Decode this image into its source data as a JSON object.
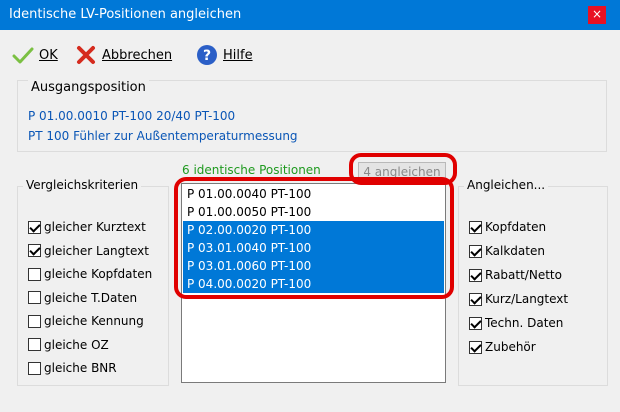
{
  "window": {
    "title": "Identische LV-Positionen angleichen",
    "close_glyph": "×"
  },
  "toolbar": {
    "ok_label": "OK",
    "ok_icon": "checkmark-icon",
    "cancel_label": "Abbrechen",
    "cancel_icon": "red-x-icon",
    "help_label": "Hilfe",
    "help_icon": "help-icon"
  },
  "source": {
    "caption": "Ausgangsposition",
    "line1": "P  01.00.0010  PT-100 20/40  PT-100",
    "line2": "PT 100 Fühler zur Außentemperaturmessung"
  },
  "criteria": {
    "caption": "Vergleichskriterien",
    "items": [
      {
        "label": "gleicher Kurztext",
        "checked": true
      },
      {
        "label": "gleicher Langtext",
        "checked": true
      },
      {
        "label": "gleiche Kopfdaten",
        "checked": false
      },
      {
        "label": "gleiche T.Daten",
        "checked": false
      },
      {
        "label": "gleiche Kennung",
        "checked": false
      },
      {
        "label": "gleiche OZ",
        "checked": false
      },
      {
        "label": "gleiche BNR",
        "checked": false
      }
    ]
  },
  "positions": {
    "count_label": "6 identische Positionen",
    "apply_button": "4 angleichen",
    "rows": [
      {
        "text": "P 01.00.0040 PT-100",
        "selected": false
      },
      {
        "text": "P 01.00.0050 PT-100",
        "selected": false
      },
      {
        "text": "P 02.00.0020 PT-100",
        "selected": true
      },
      {
        "text": "P 03.01.0040 PT-100",
        "selected": true
      },
      {
        "text": "P 03.01.0060 PT-100",
        "selected": true
      },
      {
        "text": "P 04.00.0020 PT-100",
        "selected": true
      }
    ]
  },
  "adjust": {
    "caption": "Angleichen...",
    "items": [
      {
        "label": "Kopfdaten",
        "checked": true
      },
      {
        "label": "Kalkdaten",
        "checked": true
      },
      {
        "label": "Rabatt/Netto",
        "checked": true
      },
      {
        "label": "Kurz/Langtext",
        "checked": true
      },
      {
        "label": "Techn. Daten",
        "checked": true
      },
      {
        "label": "Zubehör",
        "checked": true
      }
    ]
  },
  "colors": {
    "titlebar": "#0078d7",
    "selection": "#0078d7",
    "highlight": "#e00000",
    "source_text": "#0a56b6",
    "count_text": "#1f9a1f"
  }
}
